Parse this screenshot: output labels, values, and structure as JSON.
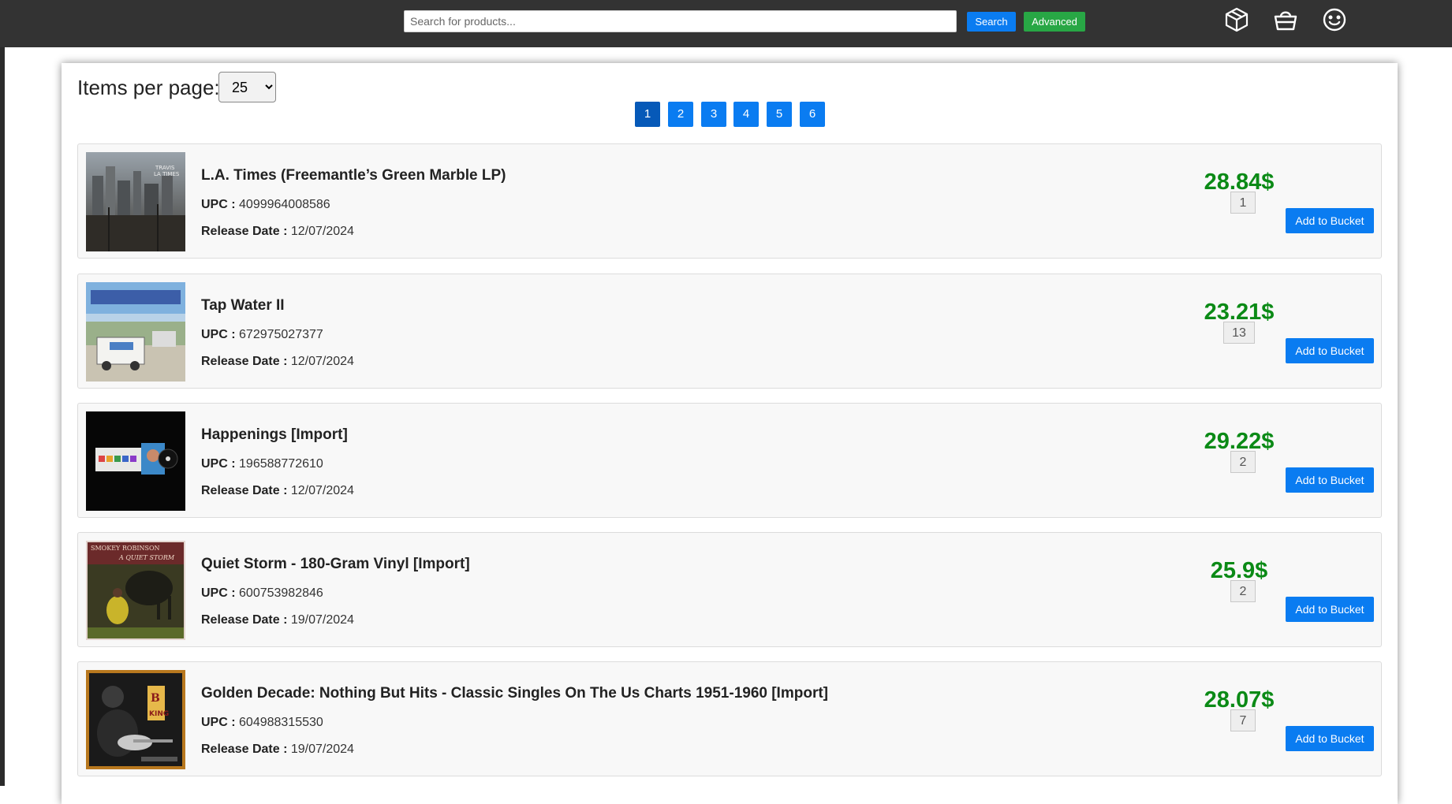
{
  "header": {
    "search_placeholder": "Search for products...",
    "search_value": "",
    "search_button": "Search",
    "advanced_button": "Advanced",
    "icons": [
      "box-icon",
      "basket-icon",
      "smiley-icon"
    ]
  },
  "controls": {
    "items_per_page_label": "Items per page:",
    "items_per_page_value": "25",
    "pages": [
      "1",
      "2",
      "3",
      "4",
      "5",
      "6"
    ],
    "current_page": "1"
  },
  "labels": {
    "upc": "UPC :",
    "release_date": "Release Date :",
    "add_button": "Add to Bucket"
  },
  "colors": {
    "primary": "#0a7cf1",
    "success": "#28a745",
    "price": "#0b8a16",
    "topbar": "#333333"
  },
  "products": [
    {
      "title": "L.A. Times (Freemantle’s Green Marble LP)",
      "upc": "4099964008586",
      "release_date": "12/07/2024",
      "quantity": "1",
      "price": "28.84$"
    },
    {
      "title": "Tap Water II",
      "upc": "672975027377",
      "release_date": "12/07/2024",
      "quantity": "13",
      "price": "23.21$"
    },
    {
      "title": "Happenings [Import]",
      "upc": "196588772610",
      "release_date": "12/07/2024",
      "quantity": "2",
      "price": "29.22$"
    },
    {
      "title": "Quiet Storm - 180-Gram Vinyl [Import]",
      "upc": "600753982846",
      "release_date": "19/07/2024",
      "quantity": "2",
      "price": "25.9$"
    },
    {
      "title": "Golden Decade: Nothing But Hits - Classic Singles On The Us Charts 1951-1960 [Import]",
      "upc": "604988315530",
      "release_date": "19/07/2024",
      "quantity": "7",
      "price": "28.07$"
    }
  ]
}
